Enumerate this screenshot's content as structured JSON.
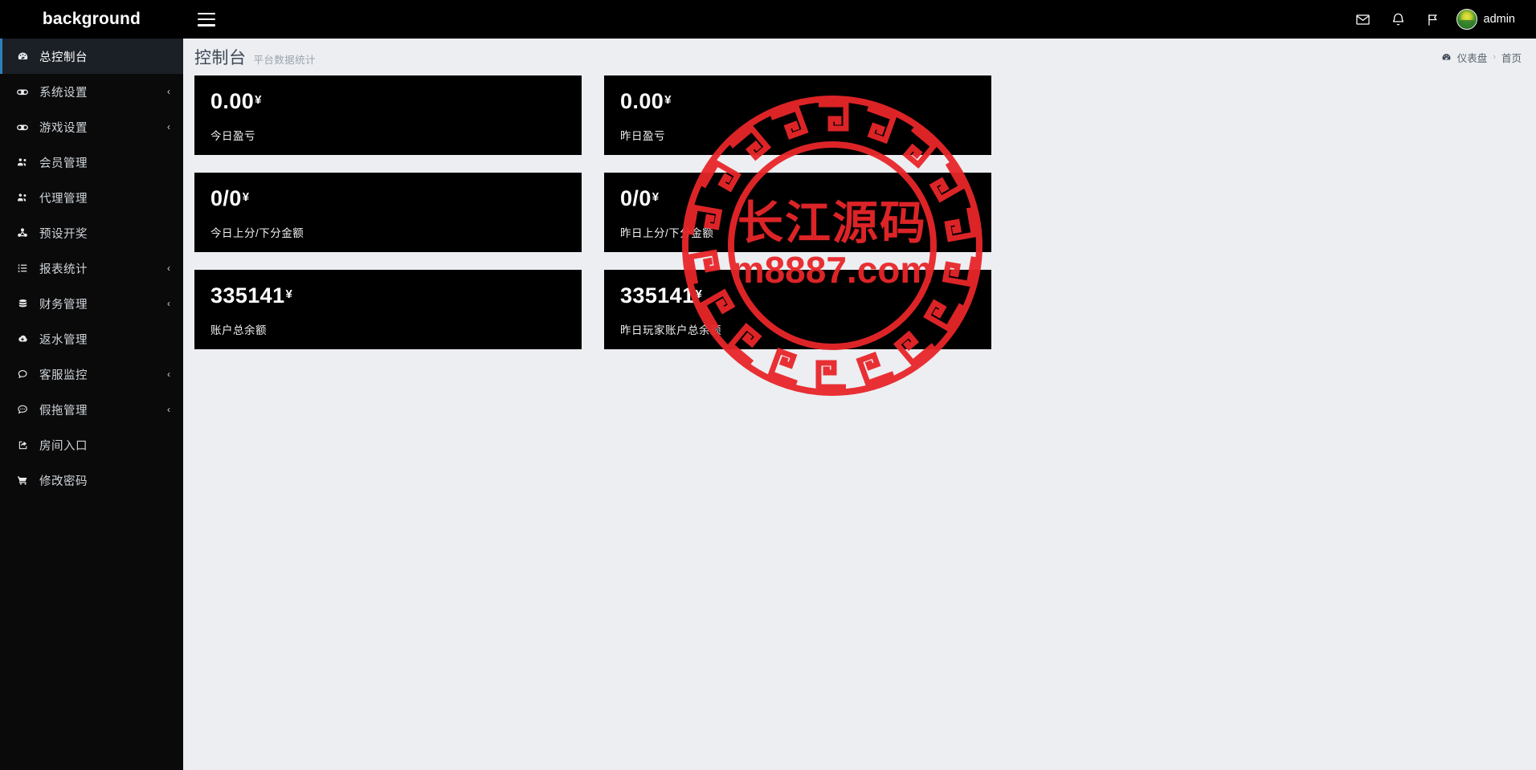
{
  "brand": {
    "title": "background"
  },
  "sidebar": {
    "items": [
      {
        "label": "总控制台",
        "icon": "dashboard-icon",
        "caret": "",
        "active": true
      },
      {
        "label": "系统设置",
        "icon": "gamepad-icon",
        "caret": "‹",
        "active": false
      },
      {
        "label": "游戏设置",
        "icon": "gamepad-icon",
        "caret": "‹",
        "active": false
      },
      {
        "label": "会员管理",
        "icon": "users-icon",
        "caret": "",
        "active": false
      },
      {
        "label": "代理管理",
        "icon": "users-icon",
        "caret": "",
        "active": false
      },
      {
        "label": "预设开奖",
        "icon": "cubes-icon",
        "caret": "",
        "active": false
      },
      {
        "label": "报表统计",
        "icon": "list-icon",
        "caret": "‹",
        "active": false
      },
      {
        "label": "财务管理",
        "icon": "database-icon",
        "caret": "‹",
        "active": false
      },
      {
        "label": "返水管理",
        "icon": "cloud-download-icon",
        "caret": "",
        "active": false
      },
      {
        "label": "客服监控",
        "icon": "comment-icon",
        "caret": "‹",
        "active": false
      },
      {
        "label": "假拖管理",
        "icon": "comment-dots-icon",
        "caret": "‹",
        "active": false
      },
      {
        "label": "房间入口",
        "icon": "external-link-icon",
        "caret": "",
        "active": false
      },
      {
        "label": "修改密码",
        "icon": "cart-icon",
        "caret": "",
        "active": false
      }
    ]
  },
  "topbar": {
    "menu_toggle": "hamburger-icon",
    "mail_icon": "envelope-icon",
    "bell_icon": "bell-icon",
    "flag_icon": "flag-icon",
    "username": "admin"
  },
  "pagehead": {
    "title": "控制台",
    "subtitle": "平台数据统计",
    "breadcrumb": {
      "icon": "dashboard-icon",
      "root": "仪表盘",
      "separator": "›",
      "current": "首页"
    }
  },
  "cards": [
    {
      "value": "0.00",
      "currency": "¥",
      "label": "今日盈亏"
    },
    {
      "value": "0.00",
      "currency": "¥",
      "label": "昨日盈亏"
    },
    {
      "value": "0/0",
      "currency": "¥",
      "label": "今日上分/下分金额"
    },
    {
      "value": "0/0",
      "currency": "¥",
      "label": "昨日上分/下分金额"
    },
    {
      "value": "335141",
      "currency": "¥",
      "label": "账户总余额"
    },
    {
      "value": "335141",
      "currency": "¥",
      "label": "昨日玩家账户总余额"
    }
  ],
  "watermark": {
    "line1": "长江源码",
    "line2": "m8887.com",
    "color": "#e8262a"
  },
  "colors": {
    "sidebar_bg": "#0a0a0a",
    "topbar_bg": "#000000",
    "page_bg": "#eceef1",
    "card_bg": "#000000",
    "accent": "#2f7fbf",
    "active_item_bg": "#1b2026"
  }
}
